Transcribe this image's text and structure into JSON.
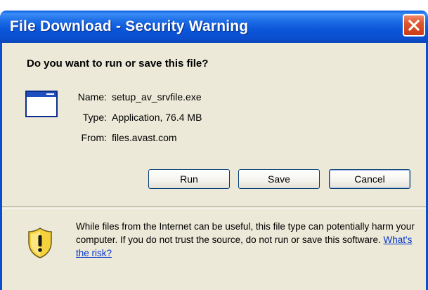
{
  "window": {
    "title": "File Download - Security Warning",
    "close_icon": "close-icon"
  },
  "dialog": {
    "question": "Do you want to run or save this file?",
    "file_icon": "application-window-icon",
    "name_label": "Name:",
    "name_value": "setup_av_srvfile.exe",
    "type_label": "Type:",
    "type_value": "Application, 76.4 MB",
    "from_label": "From:",
    "from_value": "files.avast.com"
  },
  "buttons": {
    "run": "Run",
    "save": "Save",
    "cancel": "Cancel"
  },
  "warning": {
    "icon": "shield-warning-icon",
    "text": "While files from the Internet can be useful, this file type can potentially harm your computer. If you do not trust the source, do not run or save this software.",
    "link": "What's the risk?"
  },
  "colors": {
    "titlebar": "#0a55d9",
    "body": "#ece9d8",
    "close": "#e0552e",
    "link": "#0033cc"
  }
}
